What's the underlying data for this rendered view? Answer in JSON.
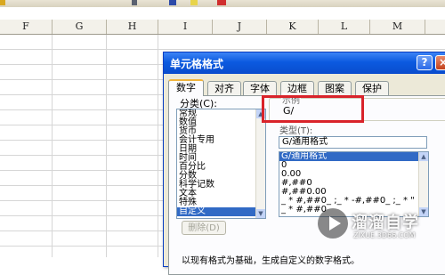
{
  "sheet": {
    "columns": [
      "F",
      "G",
      "H",
      "I",
      "J",
      "K",
      "L",
      "M"
    ]
  },
  "dialog": {
    "title": "单元格格式",
    "help_glyph": "?",
    "close_glyph": "×",
    "tabs": [
      "数字",
      "对齐",
      "字体",
      "边框",
      "图案",
      "保护"
    ],
    "active_tab": "数字",
    "category_label": "分类(C):",
    "categories": [
      "常规",
      "数值",
      "货币",
      "会计专用",
      "日期",
      "时间",
      "百分比",
      "分数",
      "科学记数",
      "文本",
      "特殊",
      "自定义"
    ],
    "selected_category": "自定义",
    "sample_label": "示例",
    "sample_value": "G/",
    "type_label": "类型(T):",
    "type_input_value": "G/通用格式",
    "type_options": [
      "G/通用格式",
      "0",
      "0.00",
      "#,##0",
      "#,##0.00",
      "_ * #,##0_ ;_ * -#,##0_ ;_ * \"",
      "_ * #,##0"
    ],
    "selected_type": "G/通用格式",
    "delete_button": "删除(D)",
    "hint_text": "以现有格式为基础，生成自定义的数字格式。"
  },
  "watermark": {
    "brand": "溜溜自学",
    "sub": "ZIXUE.3D66.COM"
  }
}
